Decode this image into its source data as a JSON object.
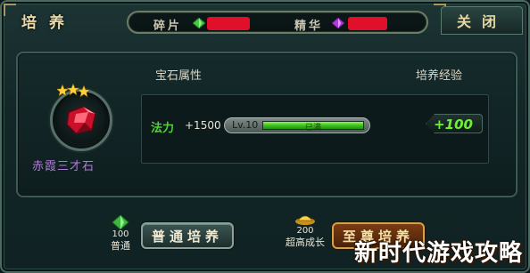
{
  "window": {
    "title": "培养",
    "close_label": "关闭"
  },
  "currencies": [
    {
      "label": "碎片",
      "icon": "green-crystal-icon",
      "value": "",
      "color": "#e0102a"
    },
    {
      "label": "精华",
      "icon": "purple-crystal-icon",
      "value": "",
      "color": "#e0102a"
    }
  ],
  "panel": {
    "gem_attr_header": "宝石属性",
    "exp_header": "培养经验",
    "gem": {
      "name": "赤霞三才石",
      "stars": 3,
      "icon": "red-gem-icon",
      "name_color": "#b07ad8"
    },
    "stat": {
      "name": "法力",
      "value": "+1500",
      "level": "Lv.10",
      "bar_status": "已满",
      "progress": 1.0,
      "exp_gain": "+100"
    }
  },
  "actions": {
    "normal": {
      "cost": "100",
      "cost_label": "普通",
      "icon": "green-crystal-icon",
      "label": "普通培养"
    },
    "supreme": {
      "cost": "200",
      "cost_label": "超高成长",
      "icon": "gold-ingot-icon",
      "label": "至尊培养"
    }
  },
  "watermark": "新时代游戏攻略",
  "colors": {
    "accent_green": "#52d23a",
    "bar_fill": "#3ec21c",
    "gold": "#d4a04a"
  }
}
